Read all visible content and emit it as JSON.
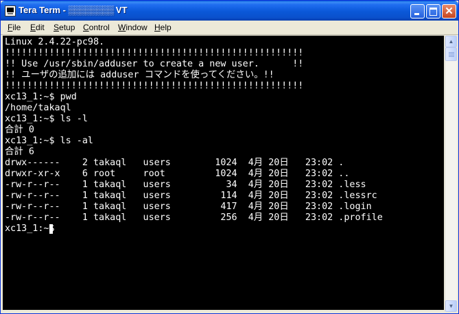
{
  "window": {
    "title": "Tera Term - ",
    "title_masked": "▒▒▒▒▒▒▒▒",
    "title_suffix": " VT",
    "icon": "teraterm-terminal-icon"
  },
  "titlebar_buttons": {
    "minimize_icon": "minimize-icon",
    "maximize_icon": "maximize-icon",
    "close_icon": "close-icon",
    "close_glyph": "✕"
  },
  "menu": {
    "items": [
      {
        "label": "File",
        "accel": "F",
        "rest": "ile"
      },
      {
        "label": "Edit",
        "accel": "E",
        "rest": "dit"
      },
      {
        "label": "Setup",
        "accel": "S",
        "rest": "etup"
      },
      {
        "label": "Control",
        "accel": "C",
        "rest": "ontrol"
      },
      {
        "label": "Window",
        "accel": "W",
        "rest": "indow"
      },
      {
        "label": "Help",
        "accel": "H",
        "rest": "elp"
      }
    ]
  },
  "terminal": {
    "lines": [
      "Linux 2.4.22-pc98.",
      "!!!!!!!!!!!!!!!!!!!!!!!!!!!!!!!!!!!!!!!!!!!!!!!!!!!!!!",
      "!! Use /usr/sbin/adduser to create a new user.      !!",
      "!! ユーザの追加には adduser コマンドを使ってください。!!",
      "!!!!!!!!!!!!!!!!!!!!!!!!!!!!!!!!!!!!!!!!!!!!!!!!!!!!!!",
      "xc13_1:~$ pwd",
      "/home/takaql",
      "xc13_1:~$ ls -l",
      "合計 0",
      "xc13_1:~$ ls -al",
      "合計 6",
      "drwx------    2 takaql   users        1024  4月 20日   23:02 .",
      "drwxr-xr-x    6 root     root         1024  4月 20日   23:02 ..",
      "-rw-r--r--    1 takaql   users          34  4月 20日   23:02 .less",
      "-rw-r--r--    1 takaql   users         114  4月 20日   23:02 .lessrc",
      "-rw-r--r--    1 takaql   users         417  4月 20日   23:02 .login",
      "-rw-r--r--    1 takaql   users         256  4月 20日   23:02 .profile",
      "xc13_1:~$"
    ]
  },
  "scrollbar": {
    "up_glyph": "▲",
    "down_glyph": "▼",
    "up_icon": "scroll-up-arrow-icon",
    "down_icon": "scroll-down-arrow-icon"
  },
  "colors": {
    "terminal_bg": "#000000",
    "terminal_fg": "#ffffff",
    "titlebar": "#0a58d8"
  }
}
